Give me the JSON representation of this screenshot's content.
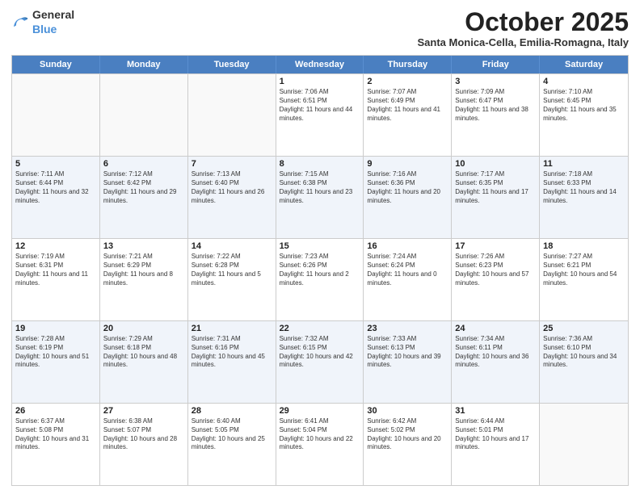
{
  "logo": {
    "general": "General",
    "blue": "Blue"
  },
  "header": {
    "month": "October 2025",
    "location": "Santa Monica-Cella, Emilia-Romagna, Italy"
  },
  "weekdays": [
    "Sunday",
    "Monday",
    "Tuesday",
    "Wednesday",
    "Thursday",
    "Friday",
    "Saturday"
  ],
  "weeks": [
    [
      {
        "day": "",
        "sunrise": "",
        "sunset": "",
        "daylight": "",
        "empty": true
      },
      {
        "day": "",
        "sunrise": "",
        "sunset": "",
        "daylight": "",
        "empty": true
      },
      {
        "day": "",
        "sunrise": "",
        "sunset": "",
        "daylight": "",
        "empty": true
      },
      {
        "day": "1",
        "sunrise": "Sunrise: 7:06 AM",
        "sunset": "Sunset: 6:51 PM",
        "daylight": "Daylight: 11 hours and 44 minutes."
      },
      {
        "day": "2",
        "sunrise": "Sunrise: 7:07 AM",
        "sunset": "Sunset: 6:49 PM",
        "daylight": "Daylight: 11 hours and 41 minutes."
      },
      {
        "day": "3",
        "sunrise": "Sunrise: 7:09 AM",
        "sunset": "Sunset: 6:47 PM",
        "daylight": "Daylight: 11 hours and 38 minutes."
      },
      {
        "day": "4",
        "sunrise": "Sunrise: 7:10 AM",
        "sunset": "Sunset: 6:45 PM",
        "daylight": "Daylight: 11 hours and 35 minutes."
      }
    ],
    [
      {
        "day": "5",
        "sunrise": "Sunrise: 7:11 AM",
        "sunset": "Sunset: 6:44 PM",
        "daylight": "Daylight: 11 hours and 32 minutes."
      },
      {
        "day": "6",
        "sunrise": "Sunrise: 7:12 AM",
        "sunset": "Sunset: 6:42 PM",
        "daylight": "Daylight: 11 hours and 29 minutes."
      },
      {
        "day": "7",
        "sunrise": "Sunrise: 7:13 AM",
        "sunset": "Sunset: 6:40 PM",
        "daylight": "Daylight: 11 hours and 26 minutes."
      },
      {
        "day": "8",
        "sunrise": "Sunrise: 7:15 AM",
        "sunset": "Sunset: 6:38 PM",
        "daylight": "Daylight: 11 hours and 23 minutes."
      },
      {
        "day": "9",
        "sunrise": "Sunrise: 7:16 AM",
        "sunset": "Sunset: 6:36 PM",
        "daylight": "Daylight: 11 hours and 20 minutes."
      },
      {
        "day": "10",
        "sunrise": "Sunrise: 7:17 AM",
        "sunset": "Sunset: 6:35 PM",
        "daylight": "Daylight: 11 hours and 17 minutes."
      },
      {
        "day": "11",
        "sunrise": "Sunrise: 7:18 AM",
        "sunset": "Sunset: 6:33 PM",
        "daylight": "Daylight: 11 hours and 14 minutes."
      }
    ],
    [
      {
        "day": "12",
        "sunrise": "Sunrise: 7:19 AM",
        "sunset": "Sunset: 6:31 PM",
        "daylight": "Daylight: 11 hours and 11 minutes."
      },
      {
        "day": "13",
        "sunrise": "Sunrise: 7:21 AM",
        "sunset": "Sunset: 6:29 PM",
        "daylight": "Daylight: 11 hours and 8 minutes."
      },
      {
        "day": "14",
        "sunrise": "Sunrise: 7:22 AM",
        "sunset": "Sunset: 6:28 PM",
        "daylight": "Daylight: 11 hours and 5 minutes."
      },
      {
        "day": "15",
        "sunrise": "Sunrise: 7:23 AM",
        "sunset": "Sunset: 6:26 PM",
        "daylight": "Daylight: 11 hours and 2 minutes."
      },
      {
        "day": "16",
        "sunrise": "Sunrise: 7:24 AM",
        "sunset": "Sunset: 6:24 PM",
        "daylight": "Daylight: 11 hours and 0 minutes."
      },
      {
        "day": "17",
        "sunrise": "Sunrise: 7:26 AM",
        "sunset": "Sunset: 6:23 PM",
        "daylight": "Daylight: 10 hours and 57 minutes."
      },
      {
        "day": "18",
        "sunrise": "Sunrise: 7:27 AM",
        "sunset": "Sunset: 6:21 PM",
        "daylight": "Daylight: 10 hours and 54 minutes."
      }
    ],
    [
      {
        "day": "19",
        "sunrise": "Sunrise: 7:28 AM",
        "sunset": "Sunset: 6:19 PM",
        "daylight": "Daylight: 10 hours and 51 minutes."
      },
      {
        "day": "20",
        "sunrise": "Sunrise: 7:29 AM",
        "sunset": "Sunset: 6:18 PM",
        "daylight": "Daylight: 10 hours and 48 minutes."
      },
      {
        "day": "21",
        "sunrise": "Sunrise: 7:31 AM",
        "sunset": "Sunset: 6:16 PM",
        "daylight": "Daylight: 10 hours and 45 minutes."
      },
      {
        "day": "22",
        "sunrise": "Sunrise: 7:32 AM",
        "sunset": "Sunset: 6:15 PM",
        "daylight": "Daylight: 10 hours and 42 minutes."
      },
      {
        "day": "23",
        "sunrise": "Sunrise: 7:33 AM",
        "sunset": "Sunset: 6:13 PM",
        "daylight": "Daylight: 10 hours and 39 minutes."
      },
      {
        "day": "24",
        "sunrise": "Sunrise: 7:34 AM",
        "sunset": "Sunset: 6:11 PM",
        "daylight": "Daylight: 10 hours and 36 minutes."
      },
      {
        "day": "25",
        "sunrise": "Sunrise: 7:36 AM",
        "sunset": "Sunset: 6:10 PM",
        "daylight": "Daylight: 10 hours and 34 minutes."
      }
    ],
    [
      {
        "day": "26",
        "sunrise": "Sunrise: 6:37 AM",
        "sunset": "Sunset: 5:08 PM",
        "daylight": "Daylight: 10 hours and 31 minutes."
      },
      {
        "day": "27",
        "sunrise": "Sunrise: 6:38 AM",
        "sunset": "Sunset: 5:07 PM",
        "daylight": "Daylight: 10 hours and 28 minutes."
      },
      {
        "day": "28",
        "sunrise": "Sunrise: 6:40 AM",
        "sunset": "Sunset: 5:05 PM",
        "daylight": "Daylight: 10 hours and 25 minutes."
      },
      {
        "day": "29",
        "sunrise": "Sunrise: 6:41 AM",
        "sunset": "Sunset: 5:04 PM",
        "daylight": "Daylight: 10 hours and 22 minutes."
      },
      {
        "day": "30",
        "sunrise": "Sunrise: 6:42 AM",
        "sunset": "Sunset: 5:02 PM",
        "daylight": "Daylight: 10 hours and 20 minutes."
      },
      {
        "day": "31",
        "sunrise": "Sunrise: 6:44 AM",
        "sunset": "Sunset: 5:01 PM",
        "daylight": "Daylight: 10 hours and 17 minutes."
      },
      {
        "day": "",
        "sunrise": "",
        "sunset": "",
        "daylight": "",
        "empty": true
      }
    ]
  ]
}
